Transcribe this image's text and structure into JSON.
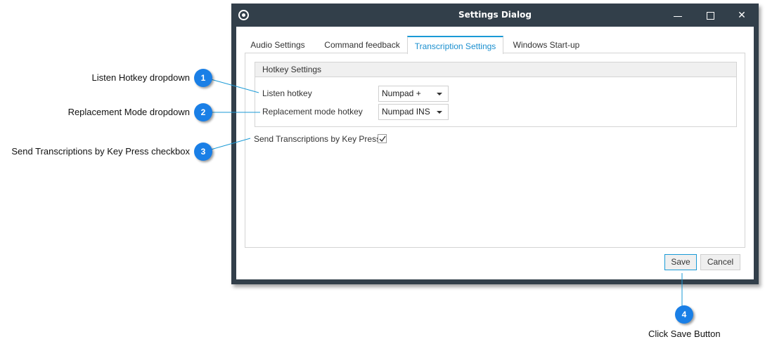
{
  "window": {
    "title": "Settings Dialog",
    "icons": {
      "app": "app-logo-icon",
      "minimize": "minimize-icon",
      "maximize": "maximize-icon",
      "close": "close-icon"
    },
    "close_glyph": "✕"
  },
  "tabs": [
    {
      "label": "Audio Settings",
      "active": false
    },
    {
      "label": "Command feedback",
      "active": false
    },
    {
      "label": "Transcription Settings",
      "active": true
    },
    {
      "label": "Windows Start-up",
      "active": false
    }
  ],
  "hotkey_group": {
    "title": "Hotkey Settings",
    "listen_label": "Listen hotkey",
    "listen_value": "Numpad +",
    "replacement_label": "Replacement mode hotkey",
    "replacement_value": "Numpad INS"
  },
  "send_by_keypress": {
    "label": "Send Transcriptions by Key Press",
    "checked": true
  },
  "buttons": {
    "save": "Save",
    "cancel": "Cancel"
  },
  "callouts": [
    {
      "number": "1",
      "text": "Listen Hotkey dropdown"
    },
    {
      "number": "2",
      "text": "Replacement Mode dropdown"
    },
    {
      "number": "3",
      "text": "Send Transcriptions by Key Press checkbox"
    },
    {
      "number": "4",
      "text": "Click Save Button"
    }
  ],
  "colors": {
    "frame": "#323f4a",
    "accent": "#1a9ad6",
    "callout": "#1a7fe6"
  }
}
